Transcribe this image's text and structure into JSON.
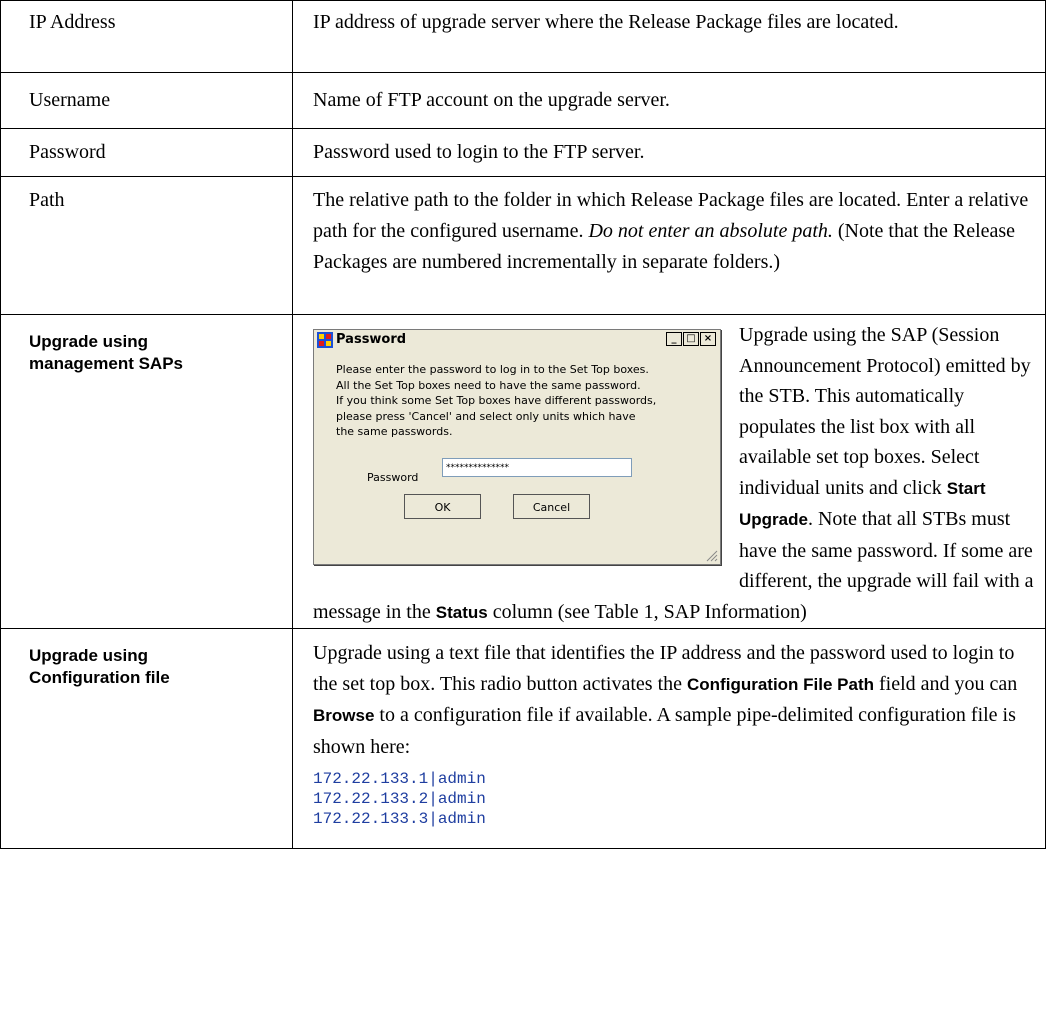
{
  "rows": [
    {
      "label": "IP Address",
      "desc": "IP address of upgrade server where the Release Package files are located."
    },
    {
      "label": "Username",
      "desc": "Name of FTP account on the upgrade server."
    },
    {
      "label": "Password",
      "desc": "Password used to login to the FTP server."
    },
    {
      "label": "Path",
      "desc_a": "The relative path to the folder in which Release Package files are located. Enter a relative path for the configured username. ",
      "desc_em": "Do not enter an absolute path.",
      "desc_b": " (Note that the Release Packages are numbered incrementally in separate folders.)"
    }
  ],
  "sap": {
    "label": "Upgrade using management SAPs",
    "text_a": "Upgrade using the SAP (Session Announcement Protocol) emitted by the STB. This automatically populates the list box with all available set top boxes. Select individual units and click ",
    "bold_a": "Start Upgrade",
    "text_b": ". Note that all STBs must have the same password. If some are different, the upgrade will fail with a message in the ",
    "bold_b": "Status",
    "text_c": " column (see Table 1,  SAP Information)"
  },
  "dialog": {
    "title": "Password",
    "message": [
      "Please enter the password to log in to the Set Top boxes.",
      "All the Set Top boxes need to have the  same password.",
      "If you think some Set Top boxes have different passwords,",
      "please press 'Cancel' and select only units which have",
      "the same passwords."
    ],
    "password_label": "Password",
    "password_value": "**************",
    "ok_label": "OK",
    "cancel_label": "Cancel",
    "min_icon": "minimize-icon",
    "max_icon": "maximize-icon",
    "close_icon": "close-icon"
  },
  "config": {
    "label": "Upgrade using Configuration file",
    "text_a": "Upgrade using a text file that identifies the IP address and the password used to login to the set top box. This radio button activates the ",
    "bold_a": "Configuration File Path",
    "text_b": " field and you can ",
    "bold_b": "Browse",
    "text_c": " to a configuration file if available. A sample pipe-delimited configuration file is shown here:",
    "sample": [
      "172.22.133.1|admin",
      "172.22.133.2|admin",
      "172.22.133.3|admin"
    ]
  }
}
